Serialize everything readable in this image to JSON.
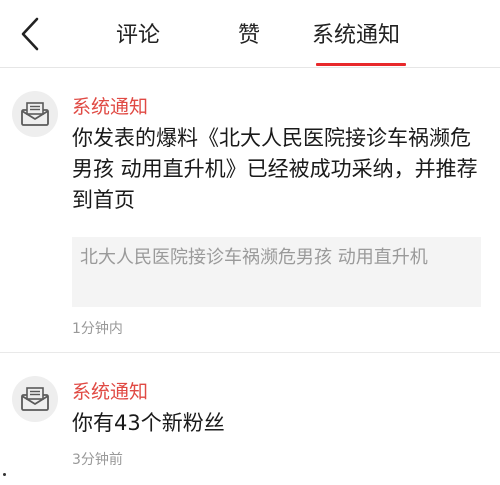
{
  "header": {
    "tabs": [
      {
        "label": "评论"
      },
      {
        "label": "赞"
      },
      {
        "label": "系统通知",
        "active": true
      }
    ],
    "accent_color": "#e8282b"
  },
  "notifications": [
    {
      "sender": "系统通知",
      "icon": "mail-envelope-icon",
      "message": "你发表的爆料《北大人民医院接诊车祸濒危男孩 动用直升机》已经被成功采纳，并推荐到首页",
      "quote": "北大人民医院接诊车祸濒危男孩 动用直升机",
      "time": "1分钟内"
    },
    {
      "sender": "系统通知",
      "icon": "mail-envelope-icon",
      "message": "你有43个新粉丝",
      "time": "3分钟前"
    }
  ],
  "colors": {
    "sender_text": "#e04a44",
    "timestamp_text": "#999999",
    "quote_background": "#f4f4f4"
  }
}
